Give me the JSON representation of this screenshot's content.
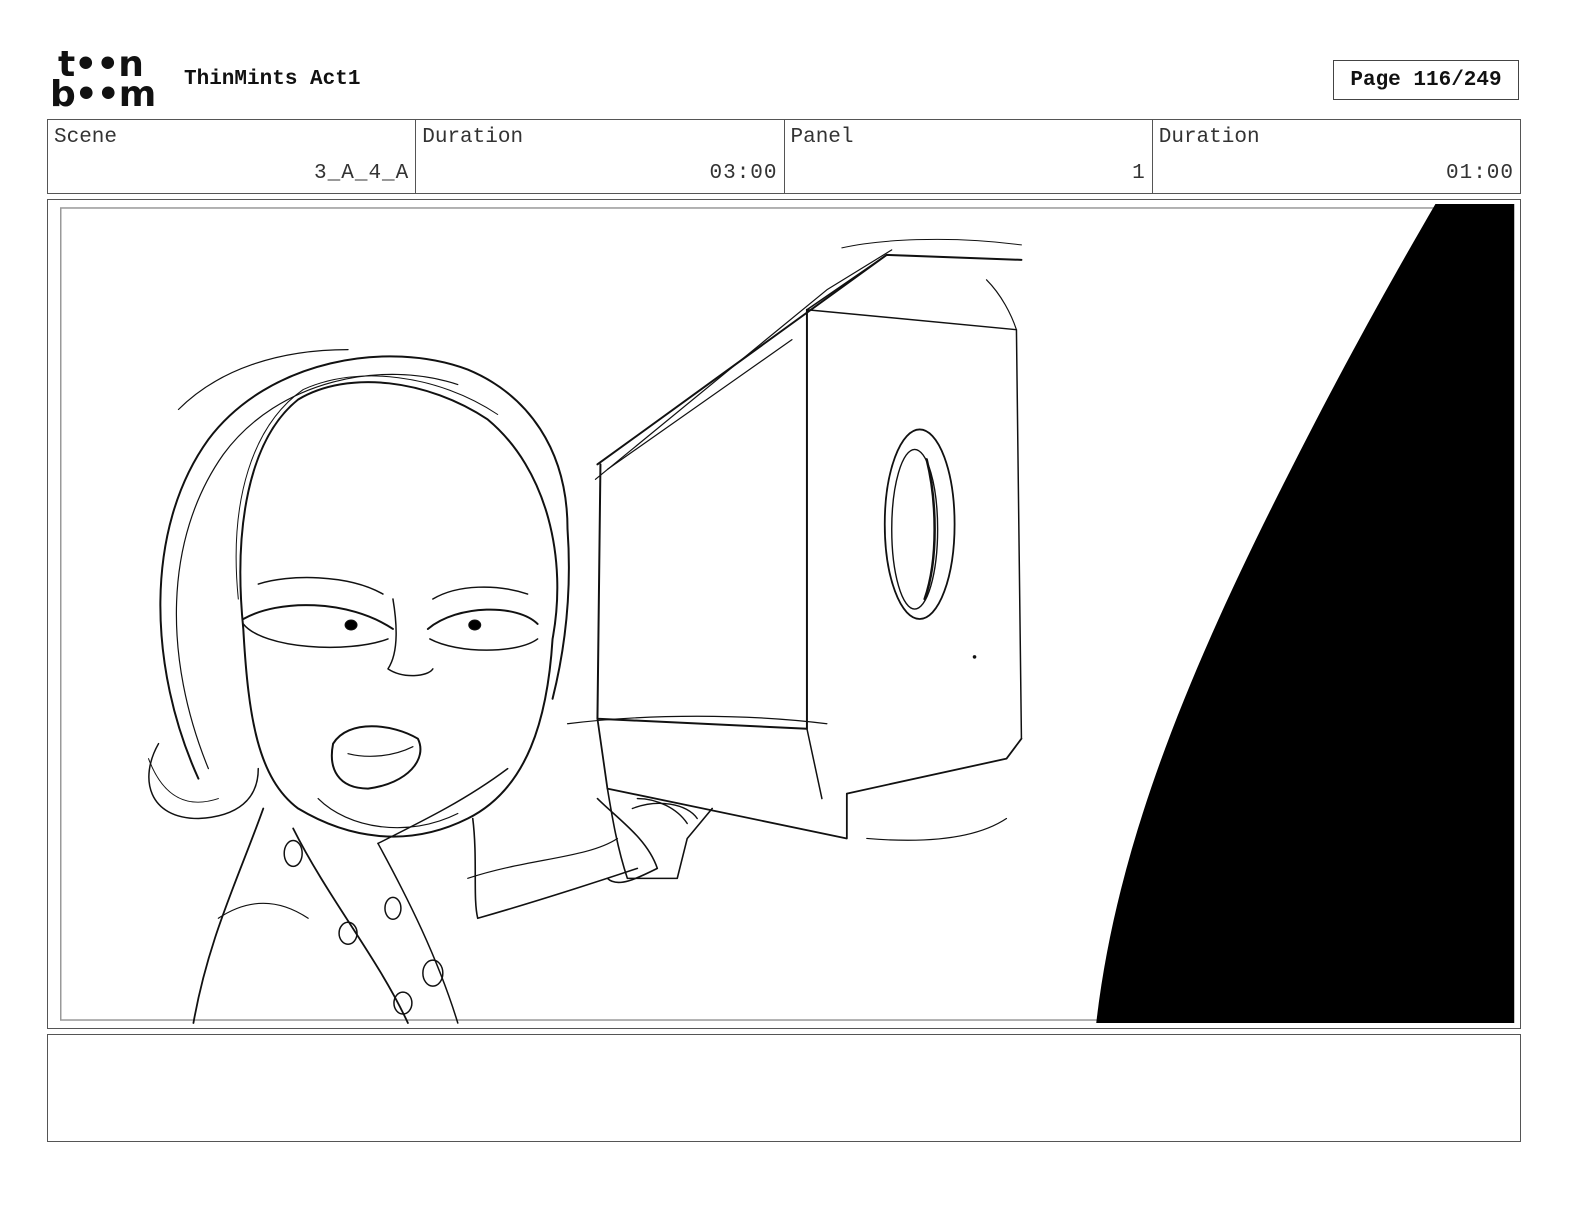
{
  "header": {
    "logo_line1": "t••n",
    "logo_line2": "b••m",
    "project_title": "ThinMints Act1",
    "page_label": "Page 116/249"
  },
  "info": {
    "scene_label": "Scene",
    "scene_value": "3_A_4_A",
    "scene_duration_label": "Duration",
    "scene_duration_value": "03:00",
    "panel_label": "Panel",
    "panel_value": "1",
    "panel_duration_label": "Duration",
    "panel_duration_value": "01:00"
  },
  "notes": {
    "text": ""
  }
}
